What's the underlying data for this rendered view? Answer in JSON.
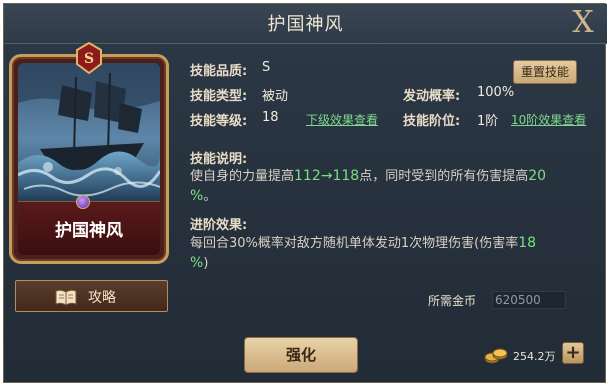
{
  "window": {
    "title": "护国神风",
    "close_label": "X"
  },
  "card": {
    "rank_letter": "S",
    "name": "护国神风"
  },
  "guide_button": {
    "label": "攻略"
  },
  "info": {
    "quality_label": "技能品质:",
    "quality_value": "S",
    "type_label": "技能类型:",
    "type_value": "被动",
    "level_label": "技能等级:",
    "level_value": "18",
    "next_effect_link": "下级效果查看",
    "trigger_label": "发动概率:",
    "trigger_value": "100%",
    "tier_label": "技能阶位:",
    "tier_value": "1阶",
    "tier10_effect_link": "10阶效果查看",
    "reset_button": "重置技能"
  },
  "description": {
    "title": "技能说明:",
    "part1": "使自身的力量提高",
    "hl1": "112→118",
    "part2": "点，同时受到的所有伤害提高",
    "hl2": "20",
    "line2_hl": "%",
    "line2_tail": "。"
  },
  "advanced": {
    "title": "进阶效果:",
    "part1": "每回合30%概率对敌方随机单体发动1次物理伤害(伤害率",
    "hl1": "18",
    "line2_hl": "%",
    "line2_tail": ")"
  },
  "cost": {
    "label": "所需金币",
    "value": "620500"
  },
  "enhance_button": "强化",
  "currency": {
    "amount": "254.2万",
    "plus_label": "+"
  },
  "colors": {
    "highlight": "#79e07e",
    "panel": "#26313d",
    "gold_border": "#c79d5c"
  }
}
